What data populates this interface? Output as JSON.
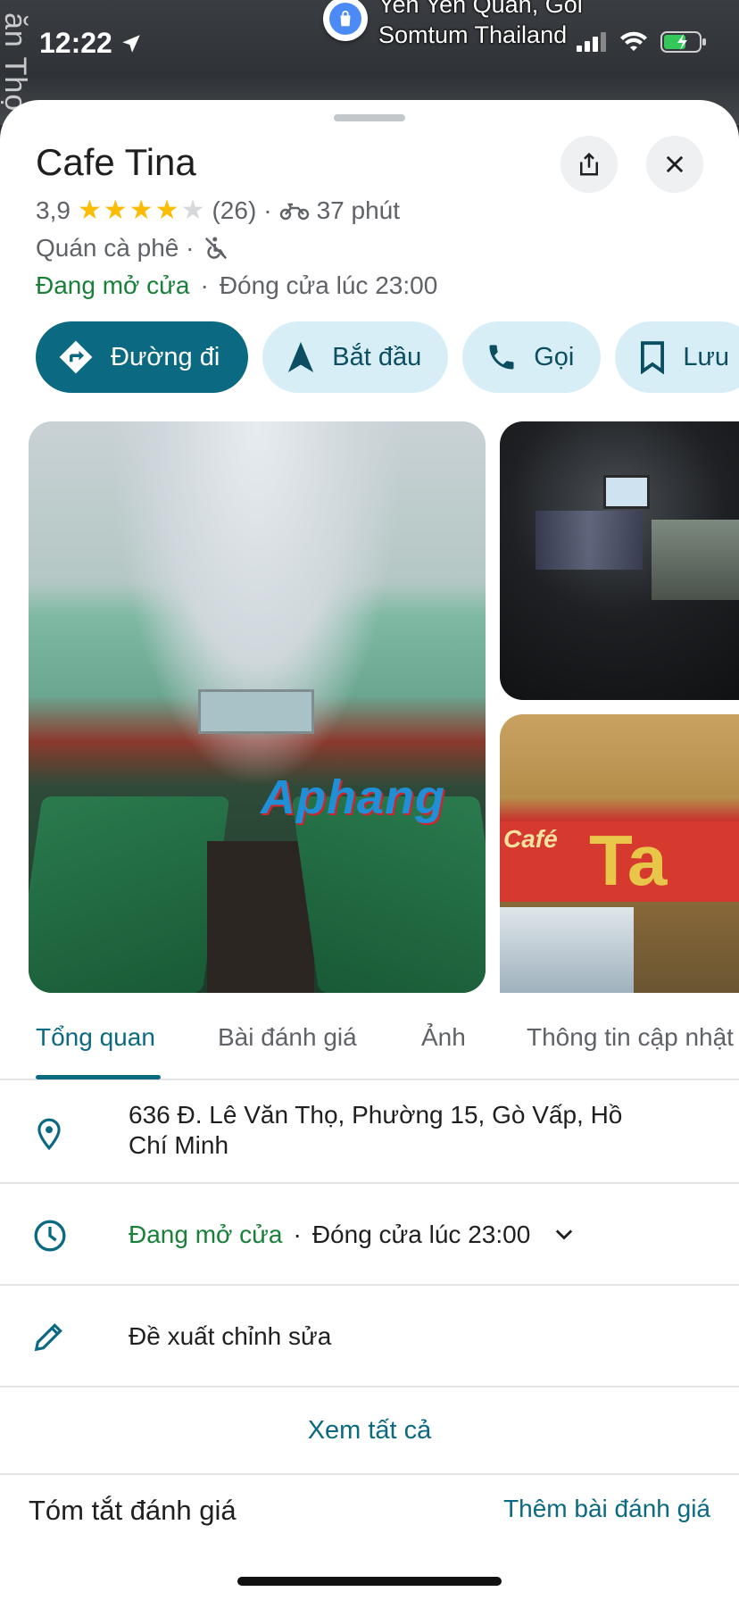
{
  "status_bar": {
    "time": "12:22",
    "location_icon": "location-arrow-icon",
    "signal_icon": "cellular-signal-icon",
    "wifi_icon": "wifi-icon",
    "battery_icon": "battery-charging-icon"
  },
  "map": {
    "street_label": "ăn Thọ",
    "poi_label_line1": "Yen Yen Quán, Gỏi",
    "poi_label_line2": "Somtum Thailand",
    "poi_icon": "shopping-bag-icon"
  },
  "place": {
    "name": "Cafe Tina",
    "rating": "3,9",
    "stars_filled": 4,
    "stars_total": 5,
    "review_count": "(26)",
    "separator": "·",
    "travel_icon": "motorbike-icon",
    "travel_time": "37 phút",
    "category": "Quán cà phê ·",
    "accessibility_icon": "no-wheelchair-icon",
    "open_status": "Đang mở cửa",
    "closing": "Đóng cửa lúc 23:00"
  },
  "header_buttons": {
    "share_icon": "share-icon",
    "close_icon": "close-icon"
  },
  "actions": [
    {
      "label": "Đường đi",
      "icon": "directions-icon",
      "primary": true
    },
    {
      "label": "Bắt đầu",
      "icon": "navigation-arrow-icon"
    },
    {
      "label": "Gọi",
      "icon": "phone-icon"
    },
    {
      "label": "Lưu",
      "icon": "bookmark-icon"
    }
  ],
  "photos": {
    "watermark": "Aphang",
    "sign_text": "Café",
    "sign_letter": "Ta"
  },
  "tabs": [
    {
      "label": "Tổng quan",
      "active": true
    },
    {
      "label": "Bài đánh giá"
    },
    {
      "label": "Ảnh"
    },
    {
      "label": "Thông tin cập nhật"
    }
  ],
  "details": {
    "address": "636 Đ. Lê Văn Thọ, Phường 15, Gò Vấp, Hồ Chí Minh",
    "address_icon": "location-pin-icon",
    "hours_open": "Đang mở cửa",
    "hours_separator": "·",
    "hours_close": "Đóng cửa lúc 23:00",
    "hours_icon": "clock-icon",
    "suggest_edit": "Đề xuất chỉnh sửa",
    "edit_icon": "pencil-icon",
    "see_all": "Xem tất cả"
  },
  "reviews": {
    "summary_title": "Tóm tắt đánh giá",
    "add_review": "Thêm bài đánh giá"
  },
  "colors": {
    "accent": "#0b6a82",
    "chip_bg": "#d8eef6",
    "open_green": "#188038",
    "star": "#fbbc04"
  }
}
